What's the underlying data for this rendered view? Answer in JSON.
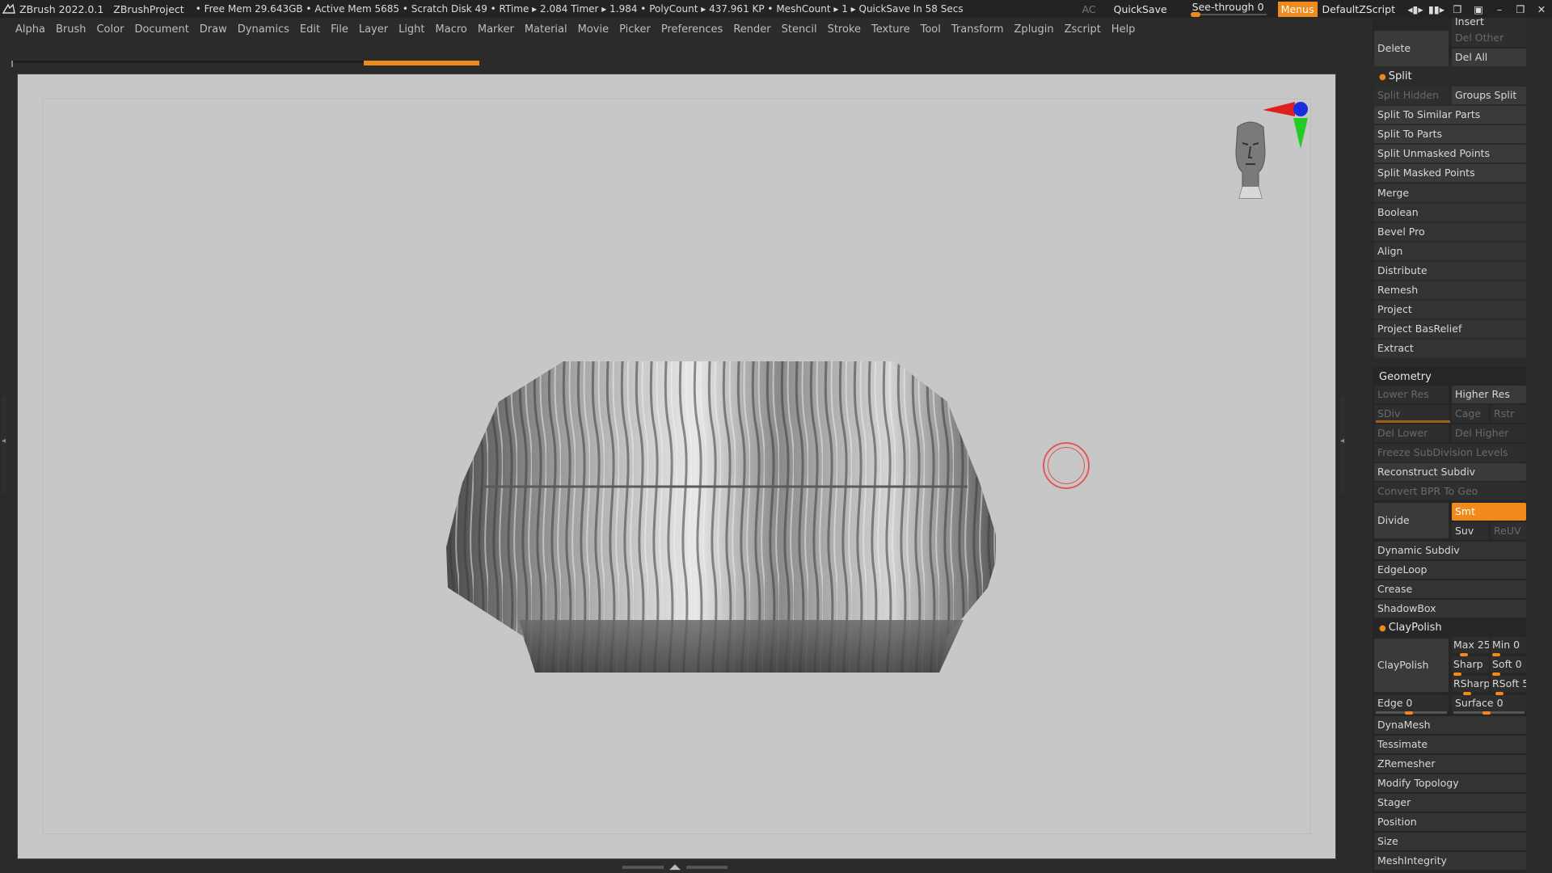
{
  "titlebar": {
    "app": "ZBrush 2022.0.1",
    "project": "ZBrushProject",
    "stats": "• Free Mem 29.643GB • Active Mem 5685 • Scratch Disk 49 •  RTime ▸ 2.084 Timer ▸ 1.984 • PolyCount ▸ 437.961 KP  • MeshCount ▸ 1  ▸ QuickSave In 58 Secs",
    "ac": "AC",
    "quicksave": "QuickSave",
    "seethrough": "See-through  0",
    "see_through_value": 0,
    "menus": "Menus",
    "defaultzscript": "DefaultZScript"
  },
  "menubar": [
    "Alpha",
    "Brush",
    "Color",
    "Document",
    "Draw",
    "Dynamics",
    "Edit",
    "File",
    "Layer",
    "Light",
    "Macro",
    "Marker",
    "Material",
    "Movie",
    "Picker",
    "Preferences",
    "Render",
    "Stencil",
    "Stroke",
    "Texture",
    "Tool",
    "Transform",
    "Zplugin",
    "Zscript",
    "Help"
  ],
  "panel": {
    "top": {
      "insert": "Insert",
      "delete": "Delete",
      "del_other": "Del Other",
      "del_all": "Del All"
    },
    "split": {
      "title": "Split",
      "split_hidden": "Split Hidden",
      "groups_split": "Groups Split",
      "split_similar": "Split To Similar Parts",
      "split_parts": "Split To Parts",
      "split_unmasked": "Split Unmasked Points",
      "split_masked": "Split Masked Points"
    },
    "subtool_items": [
      "Merge",
      "Boolean",
      "Bevel Pro",
      "Align",
      "Distribute",
      "Remesh",
      "Project",
      "Project BasRelief",
      "Extract"
    ],
    "geometry": {
      "title": "Geometry",
      "lower_res": "Lower Res",
      "higher_res": "Higher Res",
      "sdiv": "SDiv",
      "cage": "Cage",
      "rstr": "Rstr",
      "del_lower": "Del Lower",
      "del_higher": "Del Higher",
      "freeze": "Freeze SubDivision Levels",
      "reconstruct": "Reconstruct Subdiv",
      "convert_bpr": "Convert BPR To Geo",
      "divide": "Divide",
      "smt": "Smt",
      "suv": "Suv",
      "reuv": "ReUV",
      "dynamic_subdiv": "Dynamic Subdiv",
      "edgeloop": "EdgeLoop",
      "crease": "Crease",
      "shadowbox": "ShadowBox"
    },
    "claypolish": {
      "title": "ClayPolish",
      "button": "ClayPolish",
      "max": "Max 25",
      "min": "Min 0",
      "sharp": "Sharp",
      "soft": "Soft 0",
      "rsharp": "RSharp",
      "rsoft": "RSoft 5",
      "edge": "Edge 0",
      "surface": "Surface 0"
    },
    "lower_items": [
      "DynaMesh",
      "Tessimate",
      "ZRemesher",
      "Modify Topology",
      "Stager",
      "Position",
      "Size",
      "MeshIntegrity"
    ]
  },
  "colors": {
    "accent": "#f08a1c",
    "canvas": "#c7c7c7",
    "ui_bg": "#2b2b2b"
  },
  "icons": [
    "zbrush-logo-icon",
    "brush-cursor-icon",
    "axis-gizmo-icon",
    "head-orientation-icon"
  ]
}
